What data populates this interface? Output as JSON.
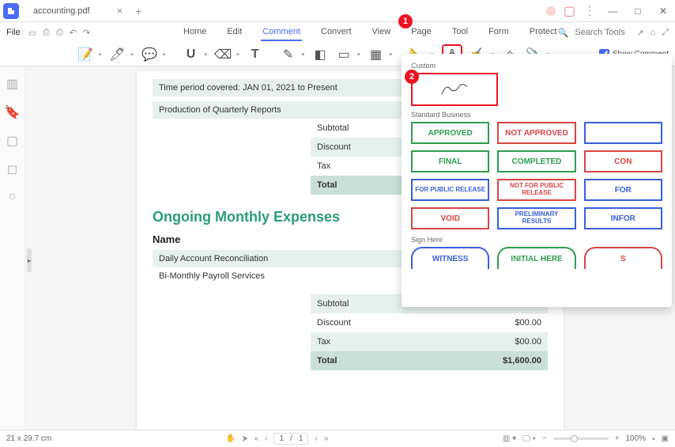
{
  "title": {
    "filename": "accounting.pdf"
  },
  "menu": {
    "file": "File",
    "tabs": [
      "Home",
      "Edit",
      "Comment",
      "Convert",
      "View",
      "Page",
      "Tool",
      "Form",
      "Protect"
    ],
    "active": "Comment",
    "search_ph": "Search Tools"
  },
  "toolbar": {
    "show_comment": "Show Comment"
  },
  "callouts": {
    "one": "1",
    "two": "2"
  },
  "doc": {
    "period": "Time period covered: JAN 01, 2021 to Present",
    "production": "Production of Quarterly Reports",
    "labels": {
      "subtotal": "Subtotal",
      "discount": "Discount",
      "tax": "Tax",
      "total": "Total"
    },
    "ongoing_title": "Ongoing Monthly Expenses",
    "name_hdr": "Name",
    "items": [
      "Daily Account Reconciliation",
      "Bi-Monthly Payroll Services"
    ],
    "summary": {
      "subtotal": "",
      "discount": "$00.00",
      "tax": "$00.00",
      "total": "$1,600.00"
    }
  },
  "stamps": {
    "custom": "Custom",
    "std": "Standard Business",
    "sign": "Sign Here",
    "grid": [
      {
        "t": "APPROVED",
        "c": "green"
      },
      {
        "t": "NOT APPROVED",
        "c": "red"
      },
      {
        "t": "",
        "c": "blue"
      },
      {
        "t": "FINAL",
        "c": "green"
      },
      {
        "t": "COMPLETED",
        "c": "green"
      },
      {
        "t": "CON",
        "c": "red"
      },
      {
        "t": "FOR PUBLIC RELEASE",
        "c": "blue",
        "sm": 1
      },
      {
        "t": "NOT FOR PUBLIC RELEASE",
        "c": "red",
        "sm": 1
      },
      {
        "t": "FOR",
        "c": "blue"
      },
      {
        "t": "VOID",
        "c": "red"
      },
      {
        "t": "PRELIMINARY RESULTS",
        "c": "blue",
        "sm": 1
      },
      {
        "t": "INFOR",
        "c": "blue"
      }
    ],
    "signrow": [
      {
        "t": "WITNESS",
        "c": "blue"
      },
      {
        "t": "INITIAL HERE",
        "c": "green"
      },
      {
        "t": "S",
        "c": "red"
      }
    ]
  },
  "status": {
    "dims": "21 x 29.7 cm",
    "page_cur": "1",
    "page_sep": "/",
    "page_total": "1",
    "zoom": "100%"
  }
}
